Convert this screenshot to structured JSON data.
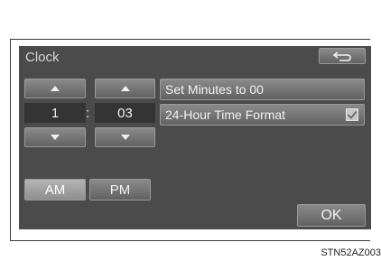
{
  "window": {
    "title": "Clock",
    "back_icon": "return-arrow-icon"
  },
  "time": {
    "hour": "1",
    "separator": ":",
    "minute": "03"
  },
  "options": {
    "set_minutes_label": "Set Minutes to 00",
    "hour_format_label": "24-Hour Time Format",
    "hour_format_checked": true
  },
  "period": {
    "am_label": "AM",
    "pm_label": "PM",
    "selected": "AM"
  },
  "ok_label": "OK",
  "caption": "STN52AZ003"
}
